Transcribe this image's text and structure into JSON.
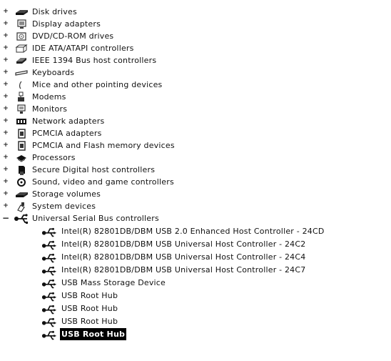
{
  "tree": {
    "categories": [
      {
        "label": "Disk drives",
        "icon": "disk-drive-icon",
        "state": "collapsed"
      },
      {
        "label": "Display adapters",
        "icon": "display-adapter-icon",
        "state": "collapsed"
      },
      {
        "label": "DVD/CD-ROM drives",
        "icon": "dvd-drive-icon",
        "state": "collapsed"
      },
      {
        "label": "IDE ATA/ATAPI controllers",
        "icon": "ide-controller-icon",
        "state": "collapsed"
      },
      {
        "label": "IEEE 1394 Bus host controllers",
        "icon": "ieee1394-icon",
        "state": "collapsed"
      },
      {
        "label": "Keyboards",
        "icon": "keyboard-icon",
        "state": "collapsed"
      },
      {
        "label": "Mice and other pointing devices",
        "icon": "mouse-icon",
        "state": "collapsed"
      },
      {
        "label": "Modems",
        "icon": "modem-icon",
        "state": "collapsed"
      },
      {
        "label": "Monitors",
        "icon": "monitor-icon",
        "state": "collapsed"
      },
      {
        "label": "Network adapters",
        "icon": "network-adapter-icon",
        "state": "collapsed"
      },
      {
        "label": "PCMCIA adapters",
        "icon": "pcmcia-icon",
        "state": "collapsed"
      },
      {
        "label": "PCMCIA and Flash memory devices",
        "icon": "flash-memory-icon",
        "state": "collapsed"
      },
      {
        "label": "Processors",
        "icon": "processor-icon",
        "state": "collapsed"
      },
      {
        "label": "Secure Digital host controllers",
        "icon": "sd-controller-icon",
        "state": "collapsed"
      },
      {
        "label": "Sound, video and game controllers",
        "icon": "sound-icon",
        "state": "collapsed"
      },
      {
        "label": "Storage volumes",
        "icon": "storage-volume-icon",
        "state": "collapsed"
      },
      {
        "label": "System devices",
        "icon": "system-device-icon",
        "state": "collapsed"
      },
      {
        "label": "Universal Serial Bus controllers",
        "icon": "usb-icon",
        "state": "expanded"
      }
    ],
    "usb_children": [
      {
        "label": "Intel(R) 82801DB/DBM USB 2.0 Enhanced Host Controller - 24CD",
        "icon": "usb-icon"
      },
      {
        "label": "Intel(R) 82801DB/DBM USB Universal Host Controller - 24C2",
        "icon": "usb-icon"
      },
      {
        "label": "Intel(R) 82801DB/DBM USB Universal Host Controller - 24C4",
        "icon": "usb-icon"
      },
      {
        "label": "Intel(R) 82801DB/DBM USB Universal Host Controller - 24C7",
        "icon": "usb-icon"
      },
      {
        "label": "USB Mass Storage Device",
        "icon": "usb-icon"
      },
      {
        "label": "USB Root Hub",
        "icon": "usb-icon"
      },
      {
        "label": "USB Root Hub",
        "icon": "usb-icon"
      },
      {
        "label": "USB Root Hub",
        "icon": "usb-icon"
      },
      {
        "label": "USB Root Hub",
        "icon": "usb-icon",
        "selected": true
      }
    ],
    "expander": {
      "collapsed": "+",
      "expanded": "−"
    }
  }
}
